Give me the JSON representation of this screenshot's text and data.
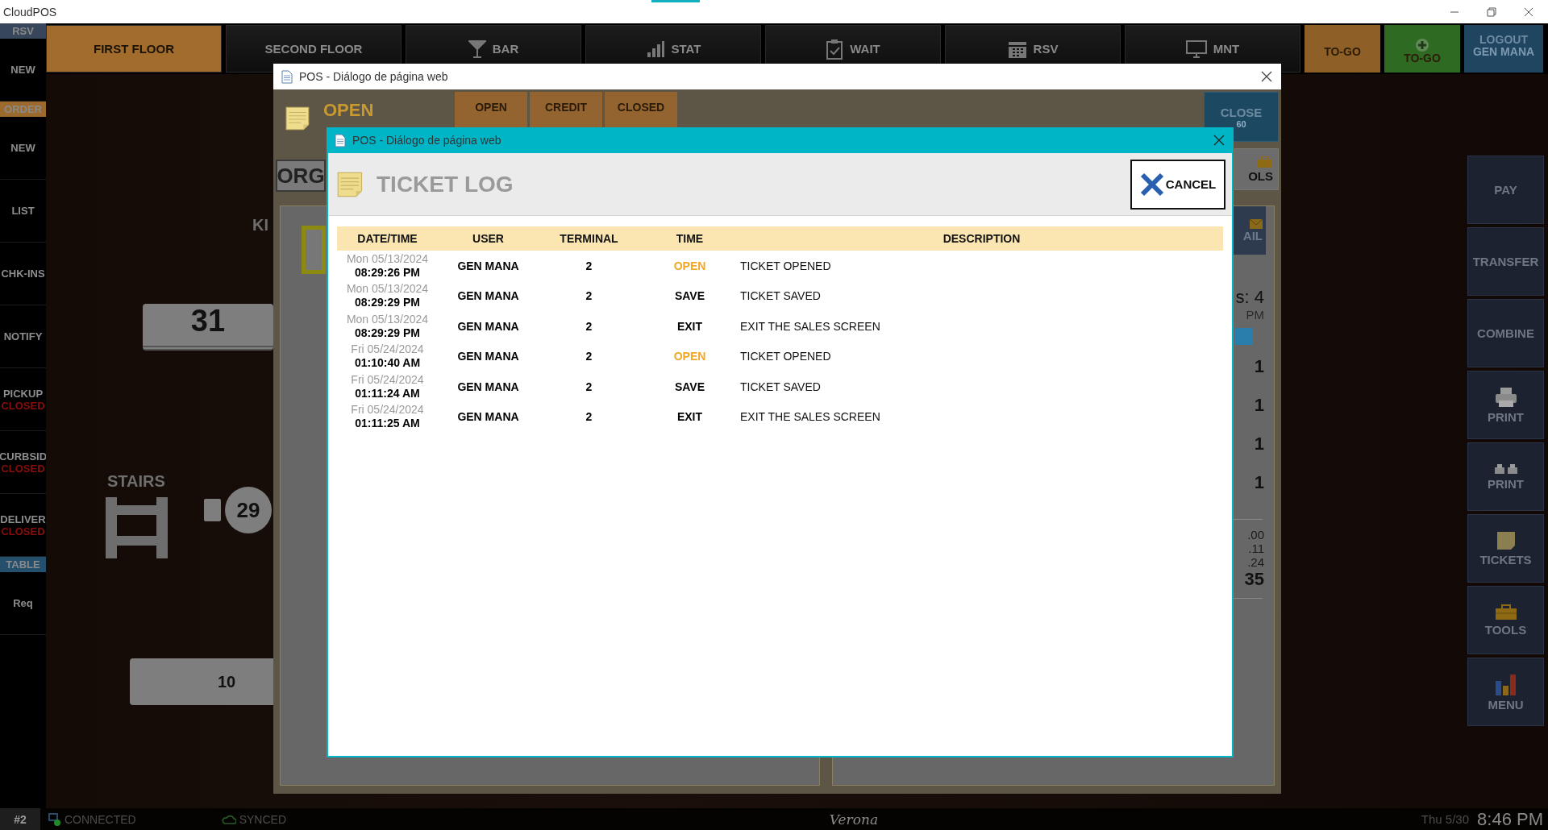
{
  "window": {
    "title": "CloudPOS"
  },
  "top_nav": {
    "tabs": [
      {
        "label": "FIRST FLOOR",
        "selected": true
      },
      {
        "label": "SECOND FLOOR",
        "selected": false
      },
      {
        "label": "BAR",
        "selected": false
      },
      {
        "label": "STAT",
        "selected": false
      },
      {
        "label": "WAIT",
        "selected": false
      },
      {
        "label": "RSV",
        "selected": false
      },
      {
        "label": "MNT",
        "selected": false
      }
    ],
    "togo": [
      {
        "label": "TO-GO",
        "kind": "plain"
      },
      {
        "label": "TO-GO",
        "kind": "add"
      }
    ],
    "logout": {
      "label": "LOGOUT",
      "user": "GEN MANA"
    }
  },
  "sidebar": [
    {
      "kind": "header",
      "label": "RSV",
      "color": "#37465a"
    },
    {
      "kind": "item",
      "label": "NEW"
    },
    {
      "kind": "header",
      "label": "ORDER",
      "color": "#9c6a2c"
    },
    {
      "kind": "item",
      "label": "NEW"
    },
    {
      "kind": "item",
      "label": "LIST"
    },
    {
      "kind": "item",
      "label": "CHK-INS"
    },
    {
      "kind": "item",
      "label": "NOTIFY"
    },
    {
      "kind": "item",
      "label": "PICKUP",
      "status": "CLOSED"
    },
    {
      "kind": "item",
      "label": "CURBSID",
      "status": "CLOSED"
    },
    {
      "kind": "item",
      "label": "DELIVER",
      "status": "CLOSED"
    },
    {
      "kind": "header",
      "label": "TABLE",
      "color": "#24506e"
    },
    {
      "kind": "item",
      "label": "Req"
    }
  ],
  "floor": [
    {
      "kind": "label",
      "text": "KI"
    },
    {
      "kind": "table",
      "text": "31"
    },
    {
      "kind": "label",
      "text": "STAIRS"
    },
    {
      "kind": "stairs"
    },
    {
      "kind": "seat"
    },
    {
      "kind": "round",
      "text": "29"
    },
    {
      "kind": "box",
      "text": "10"
    }
  ],
  "actions": [
    {
      "label": "PAY"
    },
    {
      "label": "TRANSFER"
    },
    {
      "label": "COMBINE"
    },
    {
      "label": "PRINT"
    },
    {
      "label": "PRINT"
    },
    {
      "label": "TICKETS"
    },
    {
      "label": "TOOLS"
    },
    {
      "label": "MENU"
    }
  ],
  "status_bar": {
    "terminal": "#2",
    "connection": "CONNECTED",
    "sync": "SYNCED",
    "store": "Verona",
    "date": "Thu 5/30",
    "time": "8:46 PM"
  },
  "dialog_behind": {
    "title": "POS - Diálogo de página web",
    "heading": "OPEN",
    "buttons": [
      "OPEN",
      "CREDIT",
      "CLOSED"
    ],
    "close": {
      "label": "CLOSE",
      "count": "60"
    },
    "search": "ORG",
    "tools": "OLS",
    "mail": "AIL",
    "summary": {
      "seats": "s: 4",
      "time": "PM",
      "items": [
        "1",
        "1",
        "1",
        "1"
      ],
      "totals": [
        ".00",
        ".11",
        ".24"
      ],
      "total": "35"
    }
  },
  "dialog": {
    "title": "POS - Diálogo de página web",
    "heading": "TICKET LOG",
    "cancel": "CANCEL",
    "columns": [
      "DATE/TIME",
      "USER",
      "TERMINAL",
      "TIME",
      "DESCRIPTION"
    ],
    "rows": [
      {
        "day": "Mon 05/13/2024",
        "time": "08:29:26 PM",
        "user": "GEN MANA",
        "terminal": "2",
        "action": "OPEN",
        "color": "#f5a623",
        "description": "TICKET OPENED"
      },
      {
        "day": "Mon 05/13/2024",
        "time": "08:29:29 PM",
        "user": "GEN MANA",
        "terminal": "2",
        "action": "SAVE",
        "color": "#000000",
        "description": "TICKET SAVED"
      },
      {
        "day": "Mon 05/13/2024",
        "time": "08:29:29 PM",
        "user": "GEN MANA",
        "terminal": "2",
        "action": "EXIT",
        "color": "#000000",
        "description": "EXIT THE SALES SCREEN"
      },
      {
        "day": "Fri 05/24/2024",
        "time": "01:10:40 AM",
        "user": "GEN MANA",
        "terminal": "2",
        "action": "OPEN",
        "color": "#f5a623",
        "description": "TICKET OPENED"
      },
      {
        "day": "Fri 05/24/2024",
        "time": "01:11:24 AM",
        "user": "GEN MANA",
        "terminal": "2",
        "action": "SAVE",
        "color": "#000000",
        "description": "TICKET SAVED"
      },
      {
        "day": "Fri 05/24/2024",
        "time": "01:11:25 AM",
        "user": "GEN MANA",
        "terminal": "2",
        "action": "EXIT",
        "color": "#000000",
        "description": "EXIT THE SALES SCREEN"
      }
    ]
  }
}
